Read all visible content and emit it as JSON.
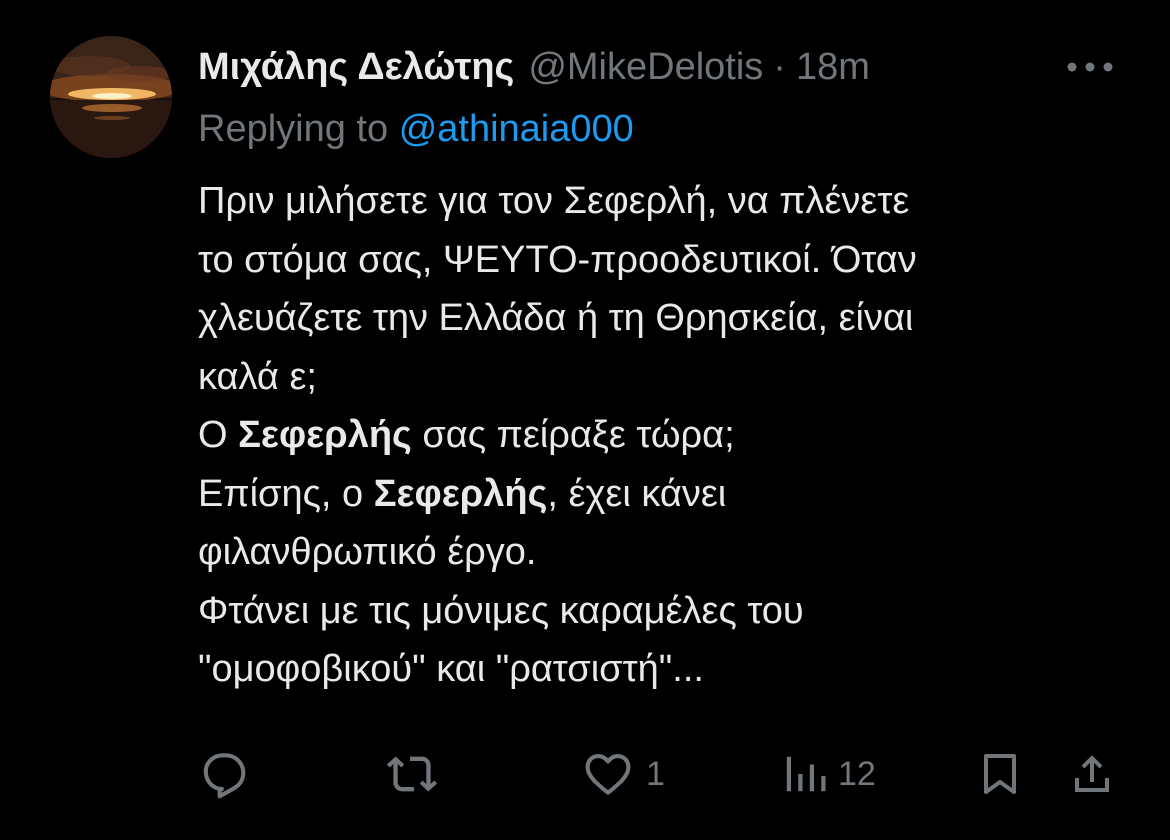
{
  "tweet": {
    "display_name": "Μιχάλης Δελώτης",
    "handle": "@MikeDelotis",
    "separator": "·",
    "time": "18m",
    "avatar_icon": "sunset-avatar",
    "replying_prefix": "Replying to",
    "replying_to": "@athinaia000",
    "body_lines": [
      [
        {
          "t": "Πριν μιλήσετε για τον Σεφερλή, να πλένετε"
        }
      ],
      [
        {
          "t": "το στόμα σας, ΨΕΥΤΟ-προοδευτικοί. Όταν"
        }
      ],
      [
        {
          "t": "χλευάζετε την Ελλάδα ή τη Θρησκεία, είναι"
        }
      ],
      [
        {
          "t": "καλά ε;"
        }
      ],
      [
        {
          "t": "Ο "
        },
        {
          "t": "Σεφερλής",
          "b": true
        },
        {
          "t": " σας πείραξε τώρα;"
        }
      ],
      [
        {
          "t": "Επίσης, ο "
        },
        {
          "t": "Σεφερλής",
          "b": true
        },
        {
          "t": ", έχει κάνει"
        }
      ],
      [
        {
          "t": "φιλανθρωπικό έργο."
        }
      ],
      [
        {
          "t": "Φτάνει με τις μόνιμες καραμέλες του"
        }
      ],
      [
        {
          "t": "\"ομοφοβικού\" και \"ρατσιστή\"..."
        }
      ]
    ]
  },
  "actions": {
    "reply": {
      "icon": "reply-icon",
      "count": ""
    },
    "retweet": {
      "icon": "retweet-icon",
      "count": ""
    },
    "like": {
      "icon": "heart-icon",
      "count": "1"
    },
    "views": {
      "icon": "views-icon",
      "count": "12"
    },
    "bookmark": {
      "icon": "bookmark-icon",
      "count": ""
    },
    "share": {
      "icon": "share-icon",
      "count": ""
    }
  },
  "colors": {
    "background": "#000000",
    "text": "#e7e9ea",
    "muted": "#71767b",
    "accent": "#1d9bf0"
  }
}
